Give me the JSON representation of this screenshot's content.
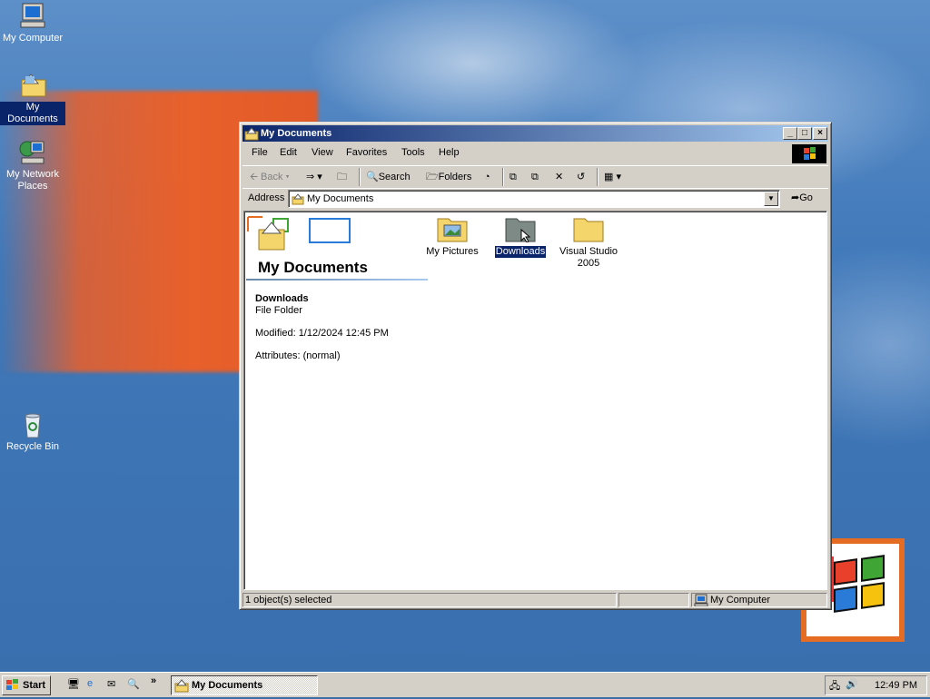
{
  "desktop": {
    "icons": [
      {
        "label": "My Computer",
        "icon": "computer-icon"
      },
      {
        "label": "My Documents",
        "icon": "my-documents-folder-icon"
      },
      {
        "label": "My Network Places",
        "icon": "network-places-icon"
      },
      {
        "label": "Recycle Bin",
        "icon": "recycle-bin-icon"
      }
    ]
  },
  "window": {
    "title": "My Documents",
    "menu": [
      "File",
      "Edit",
      "View",
      "Favorites",
      "Tools",
      "Help"
    ],
    "toolbar": {
      "back": "Back",
      "search": "Search",
      "folders": "Folders"
    },
    "address": {
      "label": "Address",
      "value": "My Documents",
      "go": "Go"
    },
    "panel": {
      "title": "My Documents",
      "selected_name": "Downloads",
      "selected_type": "File Folder",
      "modified": "Modified: 1/12/2024 12:45 PM",
      "attributes": "Attributes: (normal)"
    },
    "items": [
      {
        "label": "My Pictures",
        "icon": "pictures-folder-icon"
      },
      {
        "label": "Downloads",
        "icon": "folder-icon",
        "selected": true
      },
      {
        "label": "Visual Studio 2005",
        "icon": "folder-icon"
      }
    ],
    "status": {
      "selection": "1 object(s) selected",
      "zone": "My Computer"
    }
  },
  "taskbar": {
    "start": "Start",
    "task": "My Documents",
    "clock": "12:49 PM"
  },
  "colors": {
    "title_active": "#0a246a",
    "desktop": "#3a6ea5",
    "face": "#d4d0c8"
  }
}
